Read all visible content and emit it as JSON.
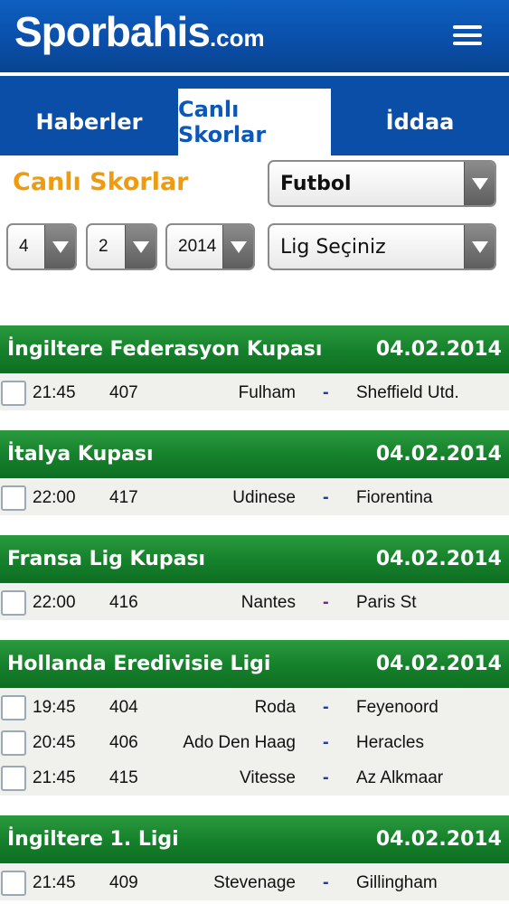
{
  "header": {
    "brand": "Sporbahis",
    "domain_suffix": ".com",
    "menu_icon": "hamburger-menu-icon"
  },
  "tabs": [
    {
      "label": "Haberler",
      "active": false
    },
    {
      "label": "Canlı Skorlar",
      "active": true
    },
    {
      "label": "İddaa",
      "active": false
    }
  ],
  "filters": {
    "title": "Canlı Skorlar",
    "sport": "Futbol",
    "day": "4",
    "month": "2",
    "year": "2014",
    "league": "Lig Seçiniz"
  },
  "leagues": [
    {
      "name": "İngiltere Federasyon Kupası",
      "date": "04.02.2014",
      "matches": [
        {
          "time": "21:45",
          "code": "407",
          "home": "Fulham",
          "separator": "-",
          "away": "Sheffield Utd."
        }
      ]
    },
    {
      "name": "İtalya Kupası",
      "date": "04.02.2014",
      "matches": [
        {
          "time": "22:00",
          "code": "417",
          "home": "Udinese",
          "separator": "-",
          "away": "Fiorentina"
        }
      ]
    },
    {
      "name": "Fransa Lig Kupası",
      "date": "04.02.2014",
      "matches": [
        {
          "time": "22:00",
          "code": "416",
          "home": "Nantes",
          "separator": "-",
          "away": "Paris St"
        }
      ]
    },
    {
      "name": "Hollanda Eredivisie Ligi",
      "date": "04.02.2014",
      "matches": [
        {
          "time": "19:45",
          "code": "404",
          "home": "Roda",
          "separator": "-",
          "away": "Feyenoord"
        },
        {
          "time": "20:45",
          "code": "406",
          "home": "Ado Den Haag",
          "separator": "-",
          "away": "Heracles"
        },
        {
          "time": "21:45",
          "code": "415",
          "home": "Vitesse",
          "separator": "-",
          "away": "Az Alkmaar"
        }
      ]
    },
    {
      "name": "İngiltere 1. Ligi",
      "date": "04.02.2014",
      "matches": [
        {
          "time": "21:45",
          "code": "409",
          "home": "Stevenage",
          "separator": "-",
          "away": "Gillingham"
        }
      ]
    }
  ],
  "colors": {
    "header_blue": "#0a4ea8",
    "title_orange": "#ef9b12",
    "league_green": "#15802b",
    "dash_blue": "#1f3fa0",
    "dash_purple": "#6a2d8e"
  }
}
